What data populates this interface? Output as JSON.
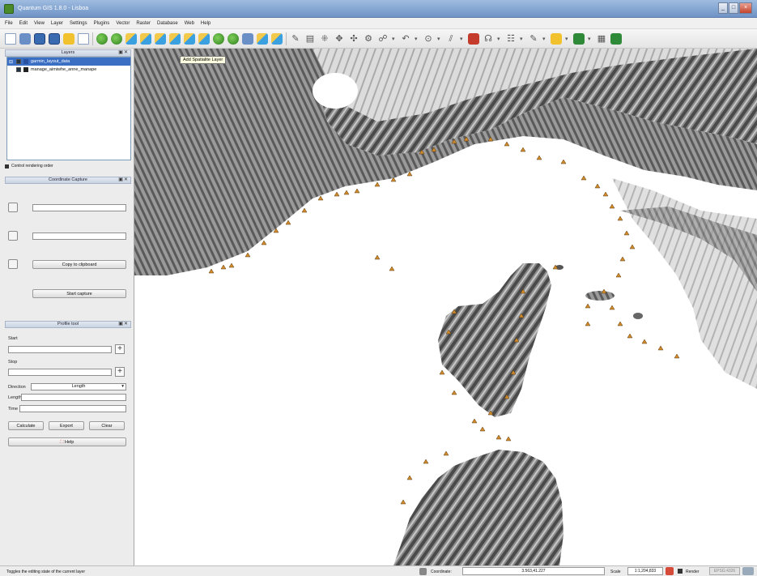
{
  "window": {
    "title": "Quantum GIS 1.8.0 - Lisboa"
  },
  "menu": [
    "File",
    "Edit",
    "View",
    "Layer",
    "Settings",
    "Plugins",
    "Vector",
    "Raster",
    "Database",
    "Web",
    "Help"
  ],
  "tooltip": "Add Spatialite Layer",
  "layers_panel": {
    "title": "Layers",
    "items": [
      {
        "label": "garmin_layout_data",
        "selected": true
      },
      {
        "label": "manage_aimiwhe_anne_manape",
        "selected": false
      }
    ],
    "render_order_label": "Control rendering order"
  },
  "georef_panel": {
    "title": "Coordinate Capture",
    "copy_button": "Copy to clipboard",
    "start_button": "Start capture"
  },
  "profile_panel": {
    "title": "Profile tool",
    "start_label": "Start",
    "stop_label": "Stop",
    "direction_label": "Direction",
    "direction_value": "Length",
    "length_label": "Length",
    "time_label": "Time",
    "buttons": [
      "Calculate",
      "Export",
      "Clear"
    ],
    "help_button": "Help"
  },
  "status": {
    "message": "Toggles the editing state of the current layer",
    "coordinate_label": "Coordinate:",
    "coordinate_value": "3.563,41.227",
    "scale_label": "Scale",
    "scale_value": "1:1,204,833",
    "render_label": "Render",
    "crs_label": "EPSG:4326"
  },
  "colors": {
    "selection": "#3a6fc4",
    "marker": "#d08a2a",
    "titlebar": "#6f93c6"
  }
}
